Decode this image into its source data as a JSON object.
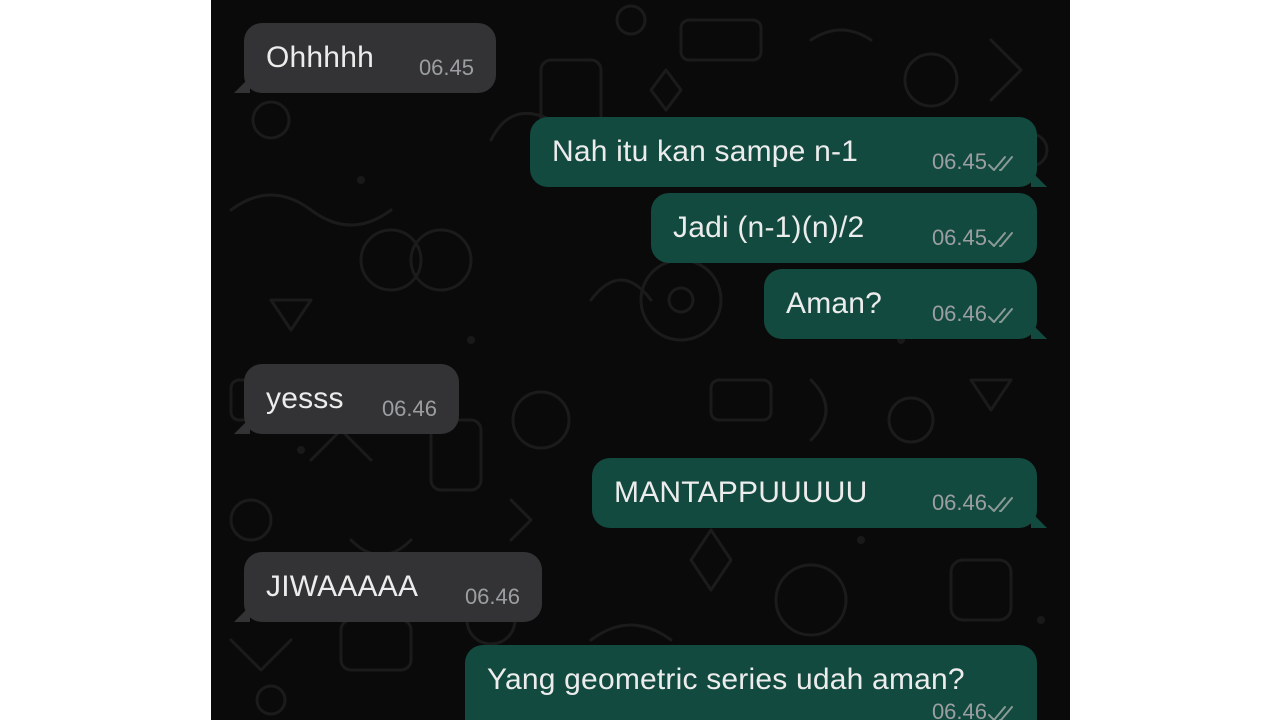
{
  "colors": {
    "chat_background": "#0a0a0a",
    "incoming_bubble": "#333335",
    "outgoing_bubble": "#124a3f",
    "message_text": "#ececec",
    "timestamp_text": "#9c9fa1",
    "read_ticks": "#8a9a96"
  },
  "messages": [
    {
      "direction": "incoming",
      "text": "Ohhhhh",
      "time": "06.45"
    },
    {
      "direction": "outgoing",
      "text": "Nah itu kan sampe n-1",
      "time": "06.45",
      "status_icon": "double-check-icon"
    },
    {
      "direction": "outgoing",
      "text": "Jadi (n-1)(n)/2",
      "time": "06.45",
      "status_icon": "double-check-icon"
    },
    {
      "direction": "outgoing",
      "text": "Aman?",
      "time": "06.46",
      "status_icon": "double-check-icon"
    },
    {
      "direction": "incoming",
      "text": "yesss",
      "time": "06.46"
    },
    {
      "direction": "outgoing",
      "text": "MANTAPPUUUUU",
      "time": "06.46",
      "status_icon": "double-check-icon"
    },
    {
      "direction": "incoming",
      "text": "JIWAAAAA",
      "time": "06.46"
    },
    {
      "direction": "outgoing",
      "text": "Yang geometric series udah aman?",
      "time": "06.46",
      "status_icon": "double-check-icon"
    }
  ]
}
